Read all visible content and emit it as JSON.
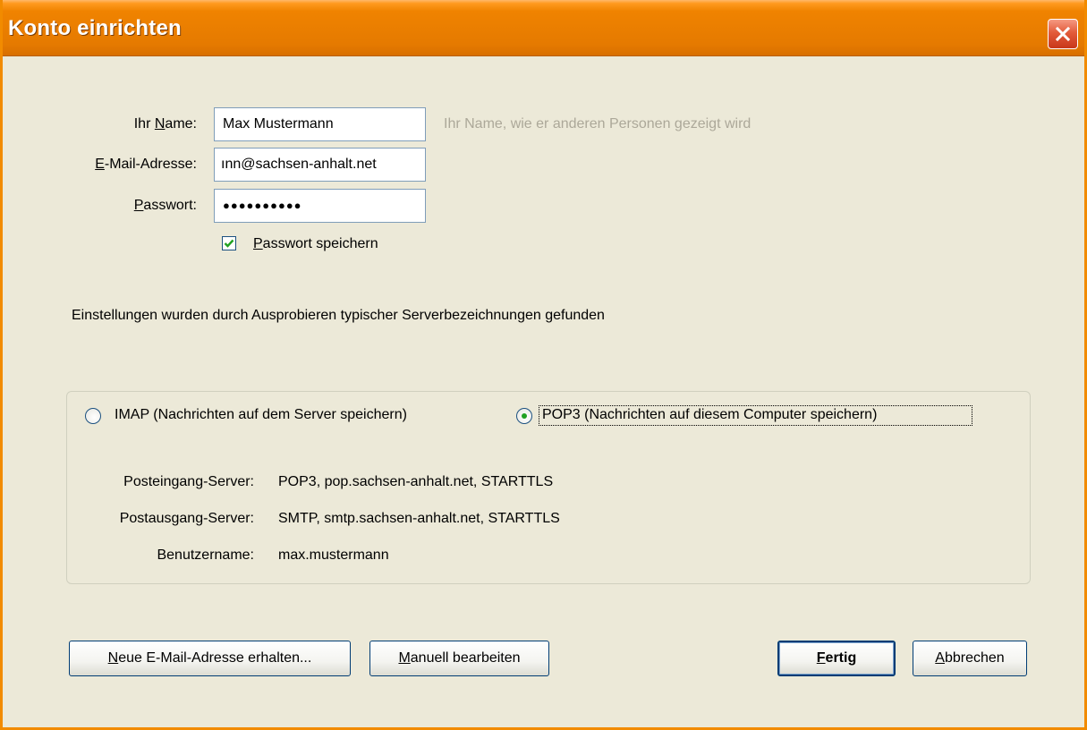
{
  "window": {
    "title": "Konto einrichten"
  },
  "form": {
    "name_label_pre": "Ihr ",
    "name_label_key": "N",
    "name_label_post": "ame:",
    "name_value": "Max Mustermann",
    "name_hint": "Ihr Name, wie er anderen Personen gezeigt wird",
    "email_label_key": "E",
    "email_label_post": "-Mail-Adresse:",
    "email_value": "ınn@sachsen-anhalt.net",
    "password_label_key": "P",
    "password_label_post": "asswort:",
    "password_value": "●●●●●●●●●●",
    "save_password_key": "P",
    "save_password_post": "asswort speichern",
    "save_password_checked": true
  },
  "status_text": "Einstellungen wurden durch Ausprobieren typischer Serverbezeichnungen gefunden",
  "server": {
    "imap_label": "IMAP (Nachrichten auf dem Server speichern)",
    "pop3_label": "POP3 (Nachrichten auf diesem Computer speichern)",
    "selected": "pop3",
    "incoming_label": "Posteingang-Server:",
    "incoming_value": "POP3, pop.sachsen-anhalt.net, STARTTLS",
    "outgoing_label": "Postausgang-Server:",
    "outgoing_value": "SMTP, smtp.sachsen-anhalt.net, STARTTLS",
    "username_label": "Benutzername:",
    "username_value": "max.mustermann"
  },
  "buttons": {
    "new_address_key": "N",
    "new_address_post": "eue E-Mail-Adresse erhalten...",
    "manual_key": "M",
    "manual_post": "anuell bearbeiten",
    "done_key": "F",
    "done_post": "ertig",
    "cancel_key": "A",
    "cancel_post": "bbrechen"
  },
  "colors": {
    "titlebar": "#f08300",
    "checkmark": "#21a121",
    "dialog_bg": "#ece9d8"
  },
  "icons": {
    "close": "close-icon",
    "check": "checkmark-icon"
  }
}
